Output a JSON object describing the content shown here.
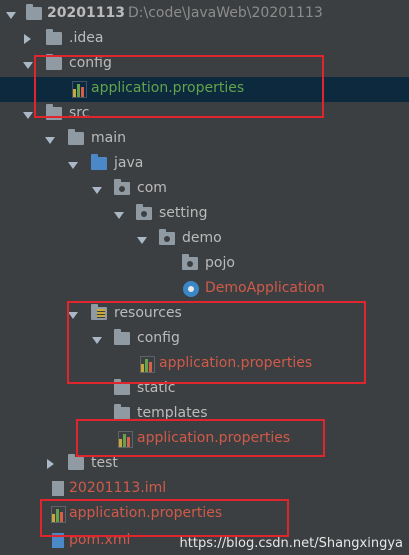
{
  "project": {
    "name": "20201113",
    "path": "D:\\code\\JavaWeb\\20201113"
  },
  "tree": {
    "idea": ".idea",
    "config": "config",
    "config_props": "application.properties",
    "src": "src",
    "main": "main",
    "java": "java",
    "com": "com",
    "setting": "setting",
    "demo": "demo",
    "pojo": "pojo",
    "demo_app": "DemoApplication",
    "resources": "resources",
    "res_config": "config",
    "res_config_props": "application.properties",
    "static": "static",
    "templates": "templates",
    "res_props": "application.properties",
    "test": "test",
    "iml": "20201113.iml",
    "root_props": "application.properties",
    "pom": "pom.xml"
  },
  "watermark": "https://blog.csdn.net/Shangxingya",
  "colors": {
    "background": "#3c3f41",
    "selection": "#0d293e",
    "highlight_box": "#e0252d",
    "green_text": "#62a34b",
    "red_text": "#d05a4a"
  }
}
